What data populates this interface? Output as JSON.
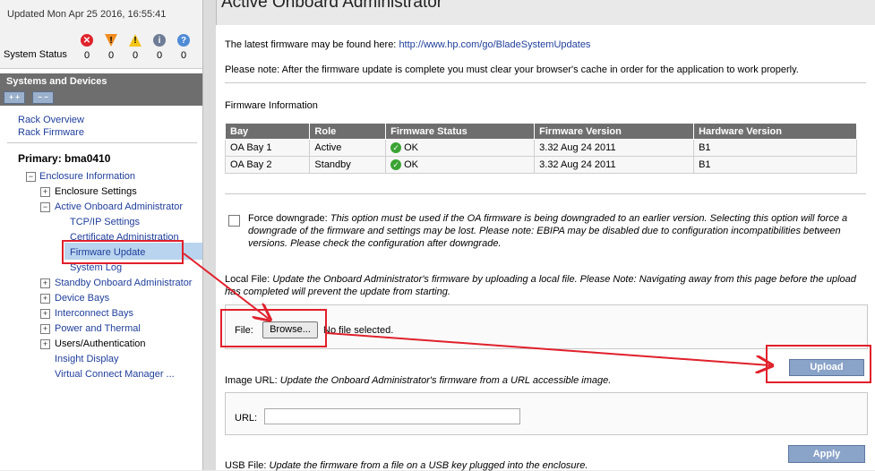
{
  "status": {
    "updated": "Updated Mon Apr 25 2016, 16:55:41",
    "label": "System Status",
    "icons": [
      {
        "name": "critical-icon",
        "glyph": "✕",
        "color": "#e0232b",
        "count": "0"
      },
      {
        "name": "major-icon",
        "glyph": "!",
        "color": "#f08c1e",
        "count": "0"
      },
      {
        "name": "minor-icon",
        "glyph": "!",
        "color": "#f5c51a",
        "count": "0"
      },
      {
        "name": "info-icon",
        "glyph": "i",
        "color": "#6e7c96",
        "count": "0"
      },
      {
        "name": "unknown-icon",
        "glyph": "?",
        "color": "#4f8bd6",
        "count": "0"
      }
    ]
  },
  "sidebar": {
    "header": "Systems and Devices",
    "expand": "+ +",
    "collapse": "− −",
    "rack_overview": "Rack Overview",
    "rack_firmware": "Rack Firmware",
    "primary": "Primary: bma0410",
    "items": {
      "enclosure_info": "Enclosure Information",
      "enclosure_settings": "Enclosure Settings",
      "active_oa": "Active Onboard Administrator",
      "tcpip": "TCP/IP Settings",
      "cert_admin": "Certificate Administration",
      "firmware_update": "Firmware Update",
      "system_log": "System Log",
      "standby_oa": "Standby Onboard Administrator",
      "device_bays": "Device Bays",
      "interconnect_bays": "Interconnect Bays",
      "power_thermal": "Power and Thermal",
      "users_auth": "Users/Authentication",
      "insight_display": "Insight Display",
      "vcm": "Virtual Connect Manager ..."
    }
  },
  "main": {
    "title": "Active Onboard Administrator",
    "firmware_text": "The latest firmware may be found here:",
    "firmware_link": "http://www.hp.com/go/BladeSystemUpdates",
    "note": "Please note: After the firmware update is complete you must clear your browser's cache in order for the application to work properly.",
    "fw_info_label": "Firmware Information",
    "table": {
      "headers": [
        "Bay",
        "Role",
        "Firmware Status",
        "Firmware Version",
        "Hardware Version"
      ],
      "rows": [
        {
          "bay": "OA Bay 1",
          "role": "Active",
          "status": "OK",
          "fw": "3.32 Aug 24 2011",
          "hw": "B1"
        },
        {
          "bay": "OA Bay 2",
          "role": "Standby",
          "status": "OK",
          "fw": "3.32 Aug 24 2011",
          "hw": "B1"
        }
      ]
    },
    "force_label": "Force downgrade:",
    "force_desc_1": "This option must be used if the OA firmware is being downgraded to an earlier version. Selecting this option will force a",
    "force_desc_2": "downgrade of the firmware and settings may be lost. Please note: EBIPA may be disabled due to configuration incompatibilities between",
    "force_desc_3": "versions. Please check the configuration after downgrade.",
    "local_label": "Local File:",
    "local_desc_1": "Update the Onboard Administrator's firmware by uploading a local file.  Please Note: Navigating away from this page before the upload",
    "local_desc_2": "has completed will prevent the update from starting.",
    "file_label": "File:",
    "browse": "Browse...",
    "no_file": "No file selected.",
    "upload": "Upload",
    "image_label": "Image URL:",
    "image_desc": "Update the Onboard Administrator's firmware from a URL accessible image.",
    "url_label": "URL:",
    "url_value": "",
    "apply": "Apply",
    "usb_label": "USB File:",
    "usb_desc": "Update the firmware from a file on a USB key plugged into the enclosure."
  },
  "annotation_color": "#e0202b"
}
